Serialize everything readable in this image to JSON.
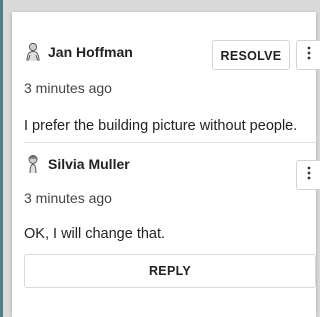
{
  "comments": [
    {
      "author": "Jan Hoffman",
      "avatar_icon": "user-avatar-icon",
      "time": "3 minutes ago",
      "text": "I prefer the building picture without people."
    },
    {
      "author": "Silvia Muller",
      "avatar_icon": "user-avatar-icon",
      "time": "3 minutes ago",
      "text": "OK, I will change that."
    }
  ],
  "actions": {
    "resolve_label": "RESOLVE",
    "more_icon": "more-vertical-icon",
    "reply_label": "REPLY"
  },
  "colors": {
    "accent_bar": "#4f7f86",
    "panel_bg": "#ffffff",
    "page_bg": "#d9d9d9"
  }
}
